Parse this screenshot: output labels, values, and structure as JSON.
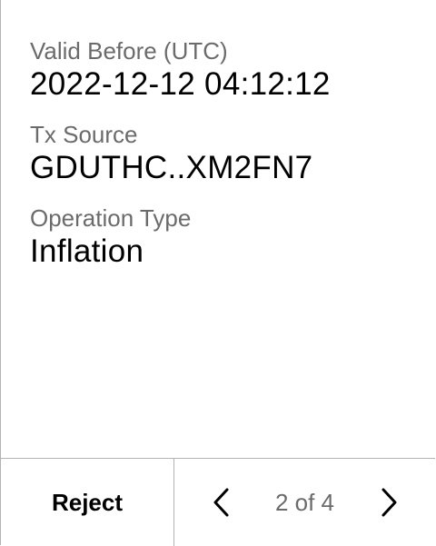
{
  "fields": [
    {
      "label": "Valid Before (UTC)",
      "value": "2022-12-12 04:12:12"
    },
    {
      "label": "Tx Source",
      "value": "GDUTHC..XM2FN7"
    },
    {
      "label": "Operation Type",
      "value": "Inflation"
    }
  ],
  "footer": {
    "reject_label": "Reject",
    "pager_text": "2 of 4",
    "prev_icon": "chevron-left-icon",
    "next_icon": "chevron-right-icon"
  },
  "colors": {
    "label": "#6b6b6b",
    "value": "#000000",
    "divider": "#b3b3b3"
  }
}
